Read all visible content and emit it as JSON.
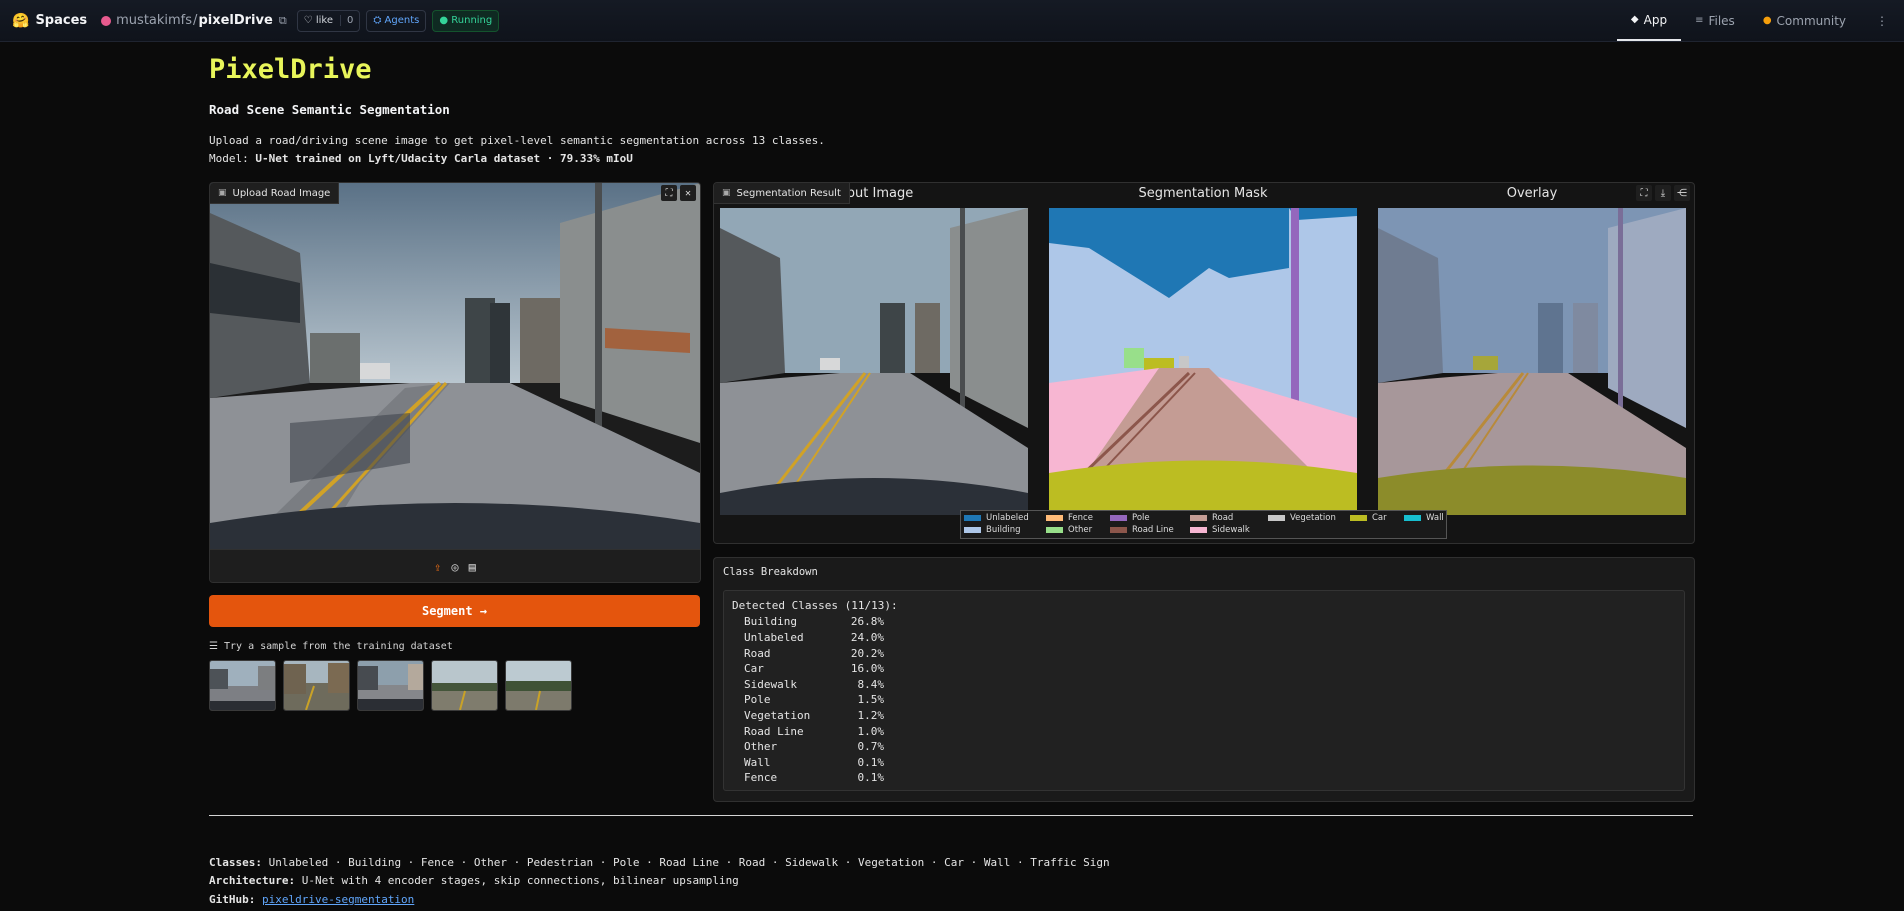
{
  "topbar": {
    "spaces_label": "Spaces",
    "owner": "mustakimfs",
    "repo": "pixelDrive",
    "like_label": "like",
    "like_count": "0",
    "agents_label": "Agents",
    "status_label": "Running",
    "tabs": [
      {
        "label": "App",
        "icon": "app-icon"
      },
      {
        "label": "Files",
        "icon": "files-icon"
      },
      {
        "label": "Community",
        "icon": "community-icon"
      }
    ]
  },
  "header": {
    "title": "PixelDrive",
    "subtitle": "Road Scene Semantic Segmentation",
    "description": "Upload a road/driving scene image to get pixel-level semantic segmentation across 13 classes.",
    "model_prefix": "Model:",
    "model_text": "U-Net trained on Lyft/Udacity Carla dataset · 79.33% mIoU"
  },
  "upload": {
    "label": "Upload Road Image",
    "segment_button": "Segment →",
    "samples_label": "Try a sample from the training dataset"
  },
  "result": {
    "label": "Segmentation Result",
    "col_titles": [
      "Input Image",
      "Segmentation Mask",
      "Overlay"
    ],
    "legend": [
      {
        "name": "Unlabeled",
        "color": "#1f77b4"
      },
      {
        "name": "Fence",
        "color": "#ffbb78"
      },
      {
        "name": "Pole",
        "color": "#9467bd"
      },
      {
        "name": "Road",
        "color": "#c49c94"
      },
      {
        "name": "Vegetation",
        "color": "#c7c7c7"
      },
      {
        "name": "Car",
        "color": "#bcbd22"
      },
      {
        "name": "Wall",
        "color": "#17becf"
      },
      {
        "name": "Building",
        "color": "#aec7e8"
      },
      {
        "name": "Other",
        "color": "#98df8a"
      },
      {
        "name": "Road Line",
        "color": "#8c564b"
      },
      {
        "name": "Sidewalk",
        "color": "#f7b6d2"
      }
    ]
  },
  "breakdown": {
    "title": "Class Breakdown",
    "header": "Detected Classes (11/13):",
    "rows": [
      {
        "name": "Building",
        "value": "26.8%"
      },
      {
        "name": "Unlabeled",
        "value": "24.0%"
      },
      {
        "name": "Road",
        "value": "20.2%"
      },
      {
        "name": "Car",
        "value": "16.0%"
      },
      {
        "name": "Sidewalk",
        "value": "8.4%"
      },
      {
        "name": "Pole",
        "value": "1.5%"
      },
      {
        "name": "Vegetation",
        "value": "1.2%"
      },
      {
        "name": "Road Line",
        "value": "1.0%"
      },
      {
        "name": "Other",
        "value": "0.7%"
      },
      {
        "name": "Wall",
        "value": "0.1%"
      },
      {
        "name": "Fence",
        "value": "0.1%"
      }
    ]
  },
  "footer": {
    "classes_label": "Classes:",
    "classes_text": "Unlabeled · Building · Fence · Other · Pedestrian · Pole · Road Line · Road · Sidewalk · Vegetation · Car · Wall · Traffic Sign",
    "arch_label": "Architecture:",
    "arch_text": "U-Net with 4 encoder stages, skip connections, bilinear upsampling",
    "github_label": "GitHub:",
    "github_link": "pixeldrive-segmentation"
  }
}
